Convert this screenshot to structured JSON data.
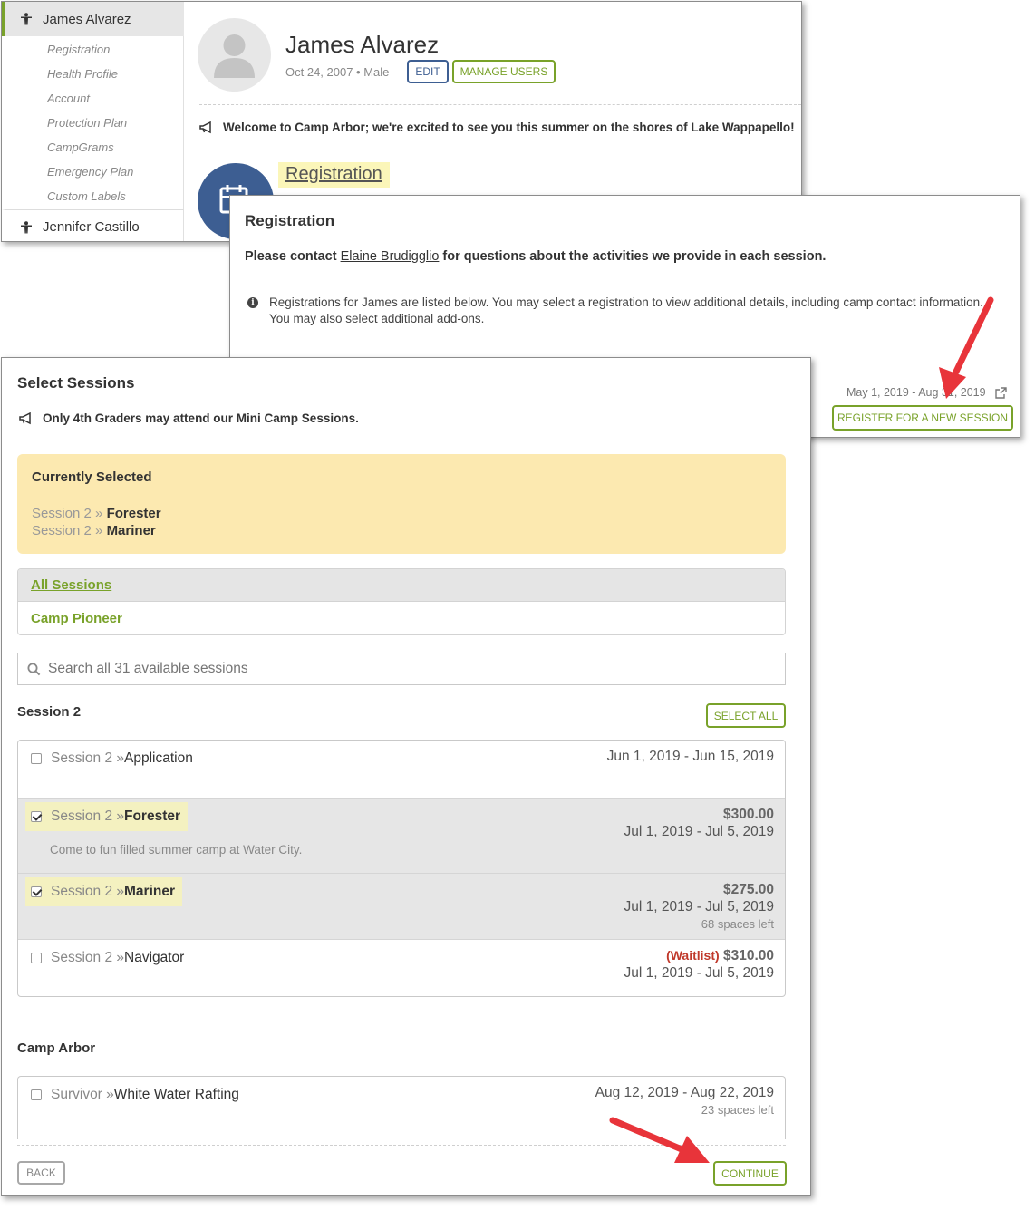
{
  "profile": {
    "name": "James Alvarez",
    "meta": "Oct 24, 2007 • Male",
    "edit_label": "EDIT",
    "manage_users_label": "MANAGE USERS",
    "welcome": "Welcome to Camp Arbor; we're excited to see you this summer on the shores of Lake Wappapello!",
    "registration_link": "Registration"
  },
  "sidebar": {
    "active_person": "James Alvarez",
    "links": [
      "Registration",
      "Health Profile",
      "Account",
      "Protection Plan",
      "CampGrams",
      "Emergency Plan",
      "Custom Labels"
    ],
    "other_person": "Jennifer Castillo"
  },
  "registration": {
    "title": "Registration",
    "contact_prefix": "Please contact ",
    "contact_name": "Elaine Brudigglio",
    "contact_suffix": " for questions about the activities we provide in each session.",
    "info": "Registrations for James are listed below. You may select a registration to view additional details, including camp contact information. You may also select additional add-ons.",
    "dates": "May 1, 2019 - Aug 31, 2019",
    "register_label": "REGISTER FOR A NEW SESSION"
  },
  "select_sessions": {
    "title": "Select Sessions",
    "note": "Only 4th Graders may attend our Mini Camp Sessions.",
    "currently_selected": {
      "heading": "Currently Selected",
      "items": [
        {
          "prefix": "Session 2 » ",
          "name": "Forester"
        },
        {
          "prefix": "Session 2 » ",
          "name": "Mariner"
        }
      ]
    },
    "filters": [
      "All Sessions",
      "Camp Pioneer"
    ],
    "search_placeholder": "Search all 31 available sessions",
    "select_all_label": "SELECT ALL",
    "groups": [
      {
        "title": "Session 2",
        "sessions": [
          {
            "prefix": "Session 2 » ",
            "name": "Application",
            "dates": "Jun 1, 2019 - Jun 15, 2019",
            "checked": false
          },
          {
            "prefix": "Session 2 » ",
            "name": "Forester",
            "price": "$300.00",
            "dates": "Jul 1, 2019 - Jul 5, 2019",
            "description": "Come to fun filled summer camp at Water City.",
            "checked": true
          },
          {
            "prefix": "Session 2 » ",
            "name": "Mariner",
            "price": "$275.00",
            "dates": "Jul 1, 2019 - Jul 5, 2019",
            "spaces": "68 spaces left",
            "checked": true
          },
          {
            "prefix": "Session 2 » ",
            "name": "Navigator",
            "waitlist": "(Waitlist)",
            "price": "$310.00",
            "dates": "Jul 1, 2019 - Jul 5, 2019",
            "checked": false
          }
        ]
      },
      {
        "title": "Camp Arbor",
        "sessions": [
          {
            "prefix": "Survivor » ",
            "name": "White Water Rafting",
            "dates": "Aug 12, 2019 - Aug 22, 2019",
            "spaces": "23 spaces left",
            "checked": false
          }
        ]
      }
    ],
    "back_label": "BACK",
    "continue_label": "CONTINUE"
  },
  "colors": {
    "accent_green": "#79a22a",
    "navy": "#3d5e92",
    "highlight_yellow": "#fce9b0",
    "arrow_red": "#e8343a"
  }
}
